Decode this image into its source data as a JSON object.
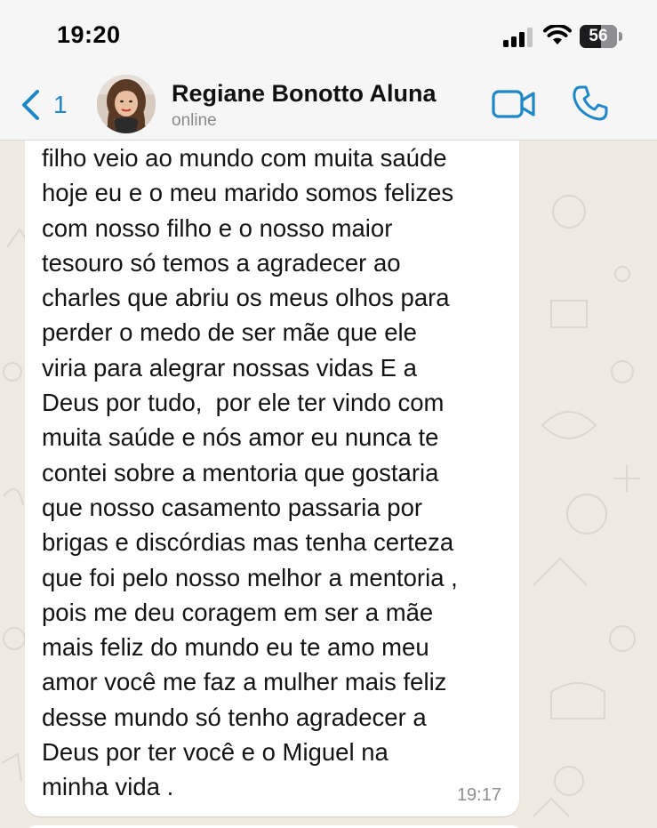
{
  "status_bar": {
    "time": "19:20",
    "battery_level": "56",
    "battery_fraction": 0.56,
    "icons": [
      "signal-icon",
      "wifi-icon",
      "battery-icon"
    ]
  },
  "header": {
    "back_count": "1",
    "contact_name": "Regiane Bonotto Aluna",
    "contact_status": "online",
    "icons": [
      "chevron-left-icon",
      "video-camera-icon",
      "phone-icon"
    ]
  },
  "colors": {
    "accent": "#1e87c8",
    "header_background": "#f6f6f6",
    "chat_background": "#efeae2",
    "bubble_background": "#ffffff",
    "text": "#141414",
    "timestamp": "#8e8e8e"
  },
  "message": {
    "text": "filho veio ao mundo com muita saúde\nhoje eu e o meu marido somos felizes\ncom nosso filho e o nosso maior\ntesouro só temos a agradecer ao\ncharles que abriu os meus olhos para\nperder o medo de ser mãe que ele\nviria para alegrar nossas vidas E a\nDeus por tudo,  por ele ter vindo com\nmuita saúde e nós amor eu nunca te\ncontei sobre a mentoria que gostaria\nque nosso casamento passaria por\nbrigas e discórdias mas tenha certeza\nque foi pelo nosso melhor a mentoria ,\npois me deu coragem em ser a mãe\nmais feliz do mundo eu te amo meu\namor você me faz a mulher mais feliz\ndesse mundo só tenho agradecer a\nDeus por ter você e o Miguel na\nminha vida .",
    "time": "19:17"
  }
}
